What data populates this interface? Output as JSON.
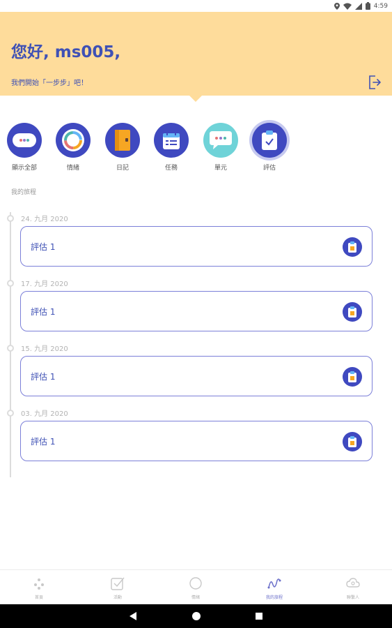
{
  "status_bar": {
    "time": "4:59"
  },
  "header": {
    "greeting": "您好, ms005,",
    "subtitle": "我們開始「一步步」吧！"
  },
  "categories": [
    {
      "label": "顯示全部",
      "icon": "chat-dots-icon"
    },
    {
      "label": "情緒",
      "icon": "mood-ring-icon"
    },
    {
      "label": "日記",
      "icon": "diary-icon"
    },
    {
      "label": "任務",
      "icon": "calendar-task-icon"
    },
    {
      "label": "單元",
      "icon": "unit-chat-icon"
    },
    {
      "label": "評估",
      "icon": "clipboard-check-icon",
      "selected": true
    }
  ],
  "section_label": "我的旅程",
  "entries": [
    {
      "date": "24. 九月 2020",
      "title": "評估 1"
    },
    {
      "date": "17. 九月 2020",
      "title": "評估 1"
    },
    {
      "date": "15. 九月 2020",
      "title": "評估 1"
    },
    {
      "date": "03. 九月 2020",
      "title": "評估 1"
    }
  ],
  "bottom_nav": [
    {
      "label": "首頁",
      "icon": "home-dots-icon"
    },
    {
      "label": "活動",
      "icon": "checkbox-icon"
    },
    {
      "label": "情緒",
      "icon": "circle-icon"
    },
    {
      "label": "我的旅程",
      "icon": "journey-icon",
      "active": true
    },
    {
      "label": "聯繫人",
      "icon": "cloud-contact-icon"
    }
  ],
  "colors": {
    "header_bg": "#fedc9b",
    "primary": "#3f51b5",
    "card_border": "#7b7fd8"
  }
}
